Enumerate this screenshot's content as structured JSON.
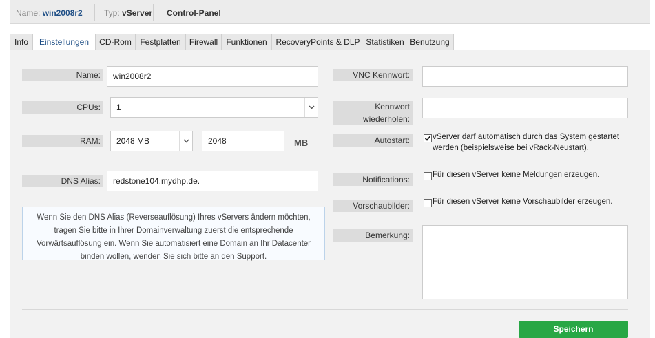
{
  "header": {
    "name_label": "Name:",
    "name_value": "win2008r2",
    "type_label": "Typ:",
    "type_value": "vServer",
    "control_panel": "Control-Panel"
  },
  "tabs": [
    {
      "label": "Info"
    },
    {
      "label": "Einstellungen"
    },
    {
      "label": "CD-Rom"
    },
    {
      "label": "Festplatten"
    },
    {
      "label": "Firewall"
    },
    {
      "label": "Funktionen"
    },
    {
      "label": "RecoveryPoints & DLP"
    },
    {
      "label": "Statistiken"
    },
    {
      "label": "Benutzung"
    }
  ],
  "active_tab": "Einstellungen",
  "form": {
    "name": {
      "label": "Name:",
      "value": "win2008r2"
    },
    "cpus": {
      "label": "CPUs:",
      "value": "1"
    },
    "ram": {
      "label": "RAM:",
      "selected": "2048 MB",
      "value": "2048",
      "unit": "MB"
    },
    "dns_alias": {
      "label": "DNS Alias:",
      "value": "redstone104.mydhp.de."
    },
    "info_text_lines": [
      "Wenn Sie den DNS Alias (Reverseauflösung) Ihres vServers ändern möchten,",
      "tragen Sie bitte in Ihrer Domainverwaltung zuerst die entsprechende",
      "Vorwärtsauflösung ein. Wenn Sie automatisiert eine Domain an Ihr Datacenter",
      "binden wollen, wenden Sie sich bitte an den Support."
    ],
    "vnc_password": {
      "label": "VNC Kennwort:",
      "value": ""
    },
    "password_repeat": {
      "label_line1": "Kennwort",
      "label_line2": "wiederholen:",
      "value": ""
    },
    "autostart": {
      "label": "Autostart:",
      "checked": true,
      "text_line1": "vServer darf automatisch durch das System gestartet",
      "text_line2": "werden (beispielsweise bei vRack-Neustart)."
    },
    "notifications": {
      "label": "Notifications:",
      "checked": false,
      "text": "Für diesen vServer keine Meldungen erzeugen."
    },
    "previews": {
      "label": "Vorschaubilder:",
      "checked": false,
      "text": "Für diesen vServer keine Vorschaubilder erzeugen."
    },
    "remark": {
      "label": "Bemerkung:",
      "value": ""
    }
  },
  "actions": {
    "save_label": "Speichern"
  },
  "colors": {
    "accent": "#1f4f86",
    "save": "#28a745",
    "info_border": "#bcd3ea"
  }
}
